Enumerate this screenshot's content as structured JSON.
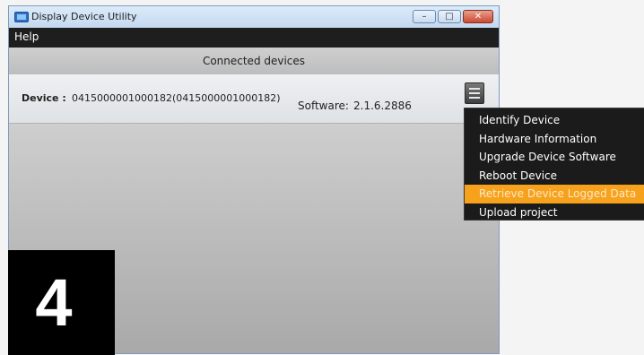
{
  "window": {
    "title": "Display Device Utility",
    "caption_buttons": [
      "–",
      "□",
      "✕"
    ]
  },
  "menubar": {
    "help_label": "Help"
  },
  "main": {
    "section_header": "Connected devices",
    "device": {
      "label": "Device :",
      "id": "0415000001000182(0415000001000182)",
      "software_label": "Software:",
      "software_version": "2.1.6.2886"
    }
  },
  "context_menu": {
    "items": [
      "Identify Device",
      "Hardware Information",
      "Upgrade Device Software",
      "Reboot Device",
      "Retrieve Device Logged Data",
      "Upload project"
    ],
    "highlight_color": "#f7a21c"
  },
  "step_badge": {
    "number": "4"
  },
  "colors": {
    "menubar": "#1e1e1e",
    "titlebar": "#c9dff2",
    "close_button": "#c94a33"
  }
}
